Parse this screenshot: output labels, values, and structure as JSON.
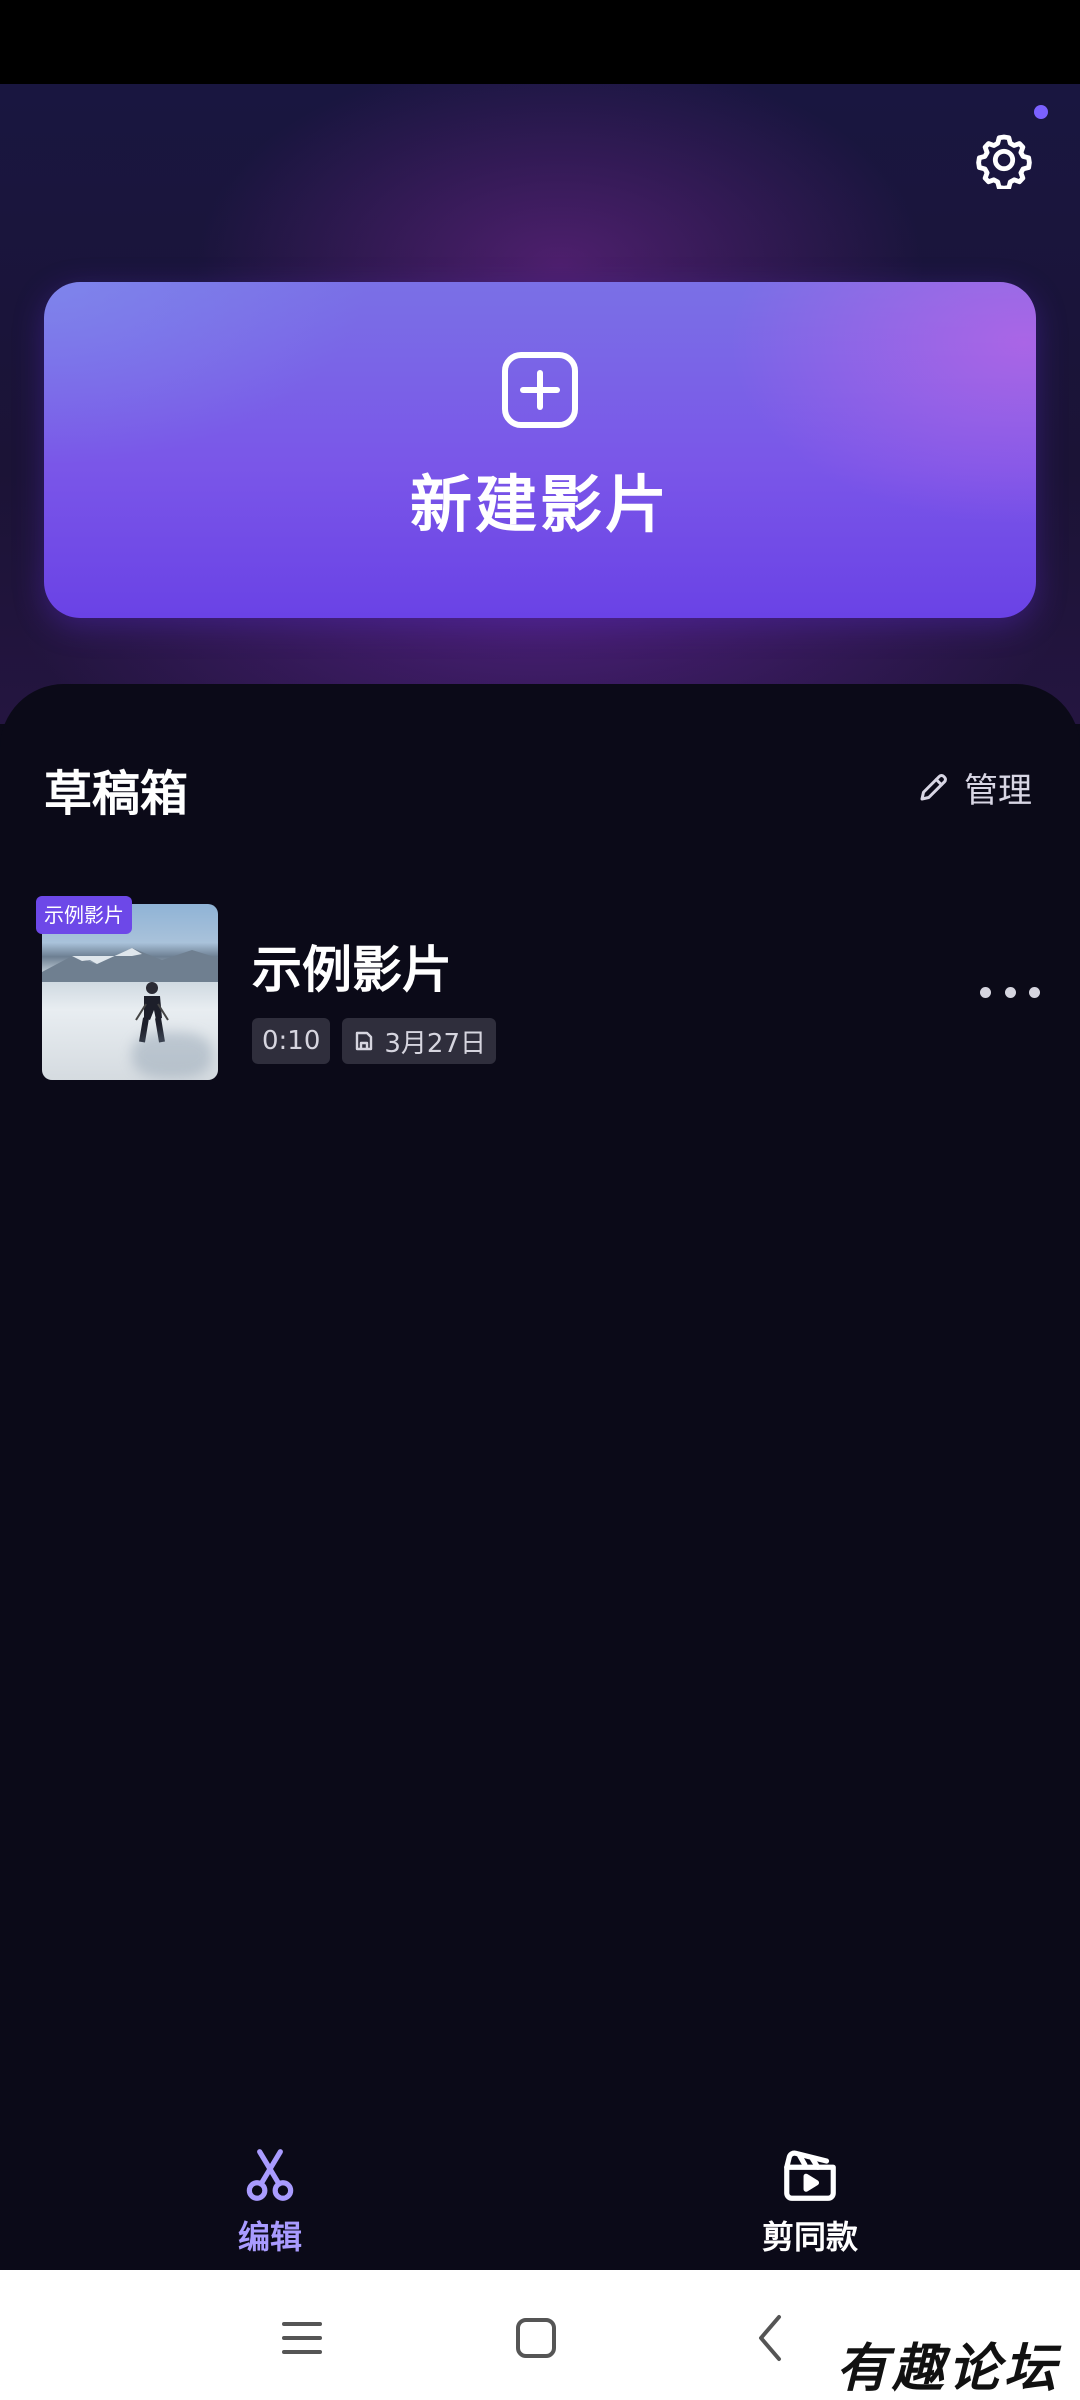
{
  "header": {
    "settings_icon": "gear-icon",
    "notification_dot_color": "#7b61ff"
  },
  "new_project": {
    "label": "新建影片",
    "icon": "plus-square-icon"
  },
  "drafts": {
    "title": "草稿箱",
    "manage_label": "管理",
    "manage_icon": "pencil-icon",
    "items": [
      {
        "badge": "示例影片",
        "name": "示例影片",
        "duration": "0:10",
        "date": "3月27日",
        "date_icon": "save-icon",
        "more_icon": "more-horizontal-icon"
      }
    ]
  },
  "tabbar": {
    "tabs": [
      {
        "label": "编辑",
        "icon": "scissors-icon",
        "active": true
      },
      {
        "label": "剪同款",
        "icon": "clapperboard-icon",
        "active": false
      }
    ]
  },
  "system_nav": {
    "menu_icon": "menu-icon",
    "home_icon": "square-icon",
    "back_icon": "back-chevron-icon"
  },
  "watermark": "有趣论坛",
  "colors": {
    "accent": "#6d48e8",
    "active_tab": "#a99bff",
    "background": "#0b0a18"
  }
}
